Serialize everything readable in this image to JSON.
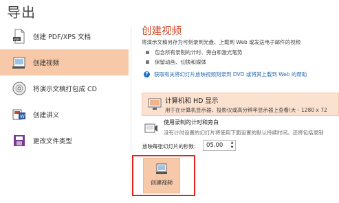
{
  "page": {
    "title": "导出"
  },
  "nav": {
    "items": [
      {
        "label": "创建 PDF/XPS 文档"
      },
      {
        "label": "创建视频"
      },
      {
        "label": "将演示文稿打包成 CD"
      },
      {
        "label": "创建讲义"
      },
      {
        "label": "更改文件类型"
      }
    ]
  },
  "video": {
    "title": "创建视频",
    "description": "将演示文稿另存为可刻录到光盘、上载到 Web 或发送电子邮件的视频",
    "bullets": [
      "包含所有录制的计时、旁白和激光笔势",
      "保留动画、切换和媒体"
    ],
    "help_link": "获取有关将幻灯片放映视频刻录到 DVD 或将其上载到 Web 的帮助",
    "quality": {
      "title": "计算机和 HD 显示",
      "subtitle": "用于在计算机显示器、投影仪或高分辨率显示器上查看(大 - 1280 x 72"
    },
    "narration": {
      "title": "使用录制的计时和旁白",
      "subtitle": "没有计时设置的幻灯片将使用下面设置的默认持续时间。还将包括录制"
    },
    "seconds_label": "放映每张幻灯片的秒数:",
    "seconds_value": "05.00",
    "create_button": "创建视频"
  },
  "colors": {
    "accent": "#d24726",
    "selected_bg": "#f7c9a9",
    "highlight": "#e2231a",
    "link": "#2b6cb0"
  }
}
